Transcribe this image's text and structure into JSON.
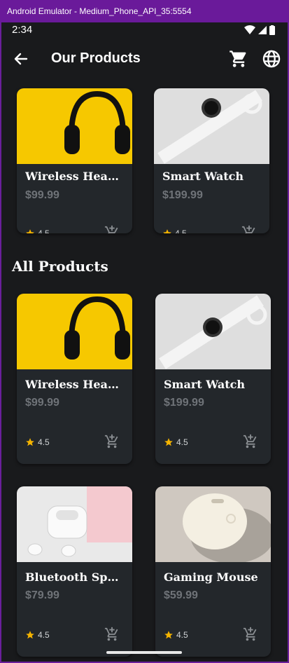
{
  "window": {
    "title": "Android Emulator - Medium_Phone_API_35:5554"
  },
  "status": {
    "time": "2:34"
  },
  "appbar": {
    "title": "Our Products"
  },
  "featured": [
    {
      "name": "Wireless Headp...",
      "price": "$99.99",
      "rating": "4.5",
      "image": "headphones"
    },
    {
      "name": "Smart Watch",
      "price": "$199.99",
      "rating": "4.5",
      "image": "smartwatch"
    }
  ],
  "section": {
    "title": "All Products"
  },
  "products": [
    {
      "name": "Wireless Headp...",
      "price": "$99.99",
      "rating": "4.5",
      "image": "headphones"
    },
    {
      "name": "Smart Watch",
      "price": "$199.99",
      "rating": "4.5",
      "image": "smartwatch"
    },
    {
      "name": "Bluetooth Speaker",
      "price": "$79.99",
      "rating": "4.5",
      "image": "earbuds"
    },
    {
      "name": "Gaming Mouse",
      "price": "$59.99",
      "rating": "4.5",
      "image": "mouse"
    }
  ],
  "colors": {
    "accent_star": "#f5b400",
    "background": "#191a1c",
    "card": "#23272b",
    "price": "#6f7378"
  }
}
